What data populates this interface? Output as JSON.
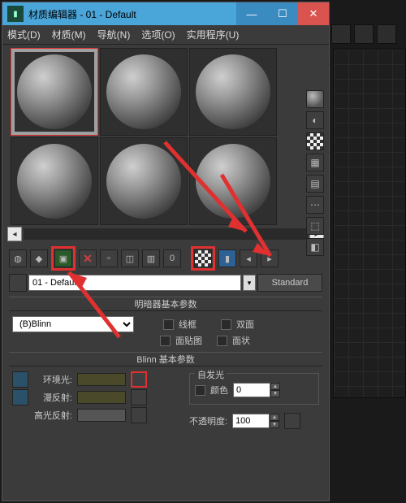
{
  "title": "材质编辑器 - 01 - Default",
  "menu": {
    "mode": "模式(D)",
    "material": "材质(M)",
    "nav": "导航(N)",
    "options": "选项(O)",
    "util": "实用程序(U)"
  },
  "material_name": "01 - Default",
  "type_button": "Standard",
  "rollout_shader": "明暗器基本参数",
  "shader_select": "(B)Blinn",
  "checks": {
    "wire": "线框",
    "two": "双面",
    "facemap": "面贴图",
    "faceted": "面状"
  },
  "rollout_blinn": "Blinn 基本参数",
  "labels": {
    "ambient": "环境光:",
    "diffuse": "漫反射:",
    "specular": "高光反射:"
  },
  "group_selfillum": "自发光",
  "label_color": "颜色",
  "val_color": "0",
  "label_opacity": "不透明度:",
  "val_opacity": "100"
}
